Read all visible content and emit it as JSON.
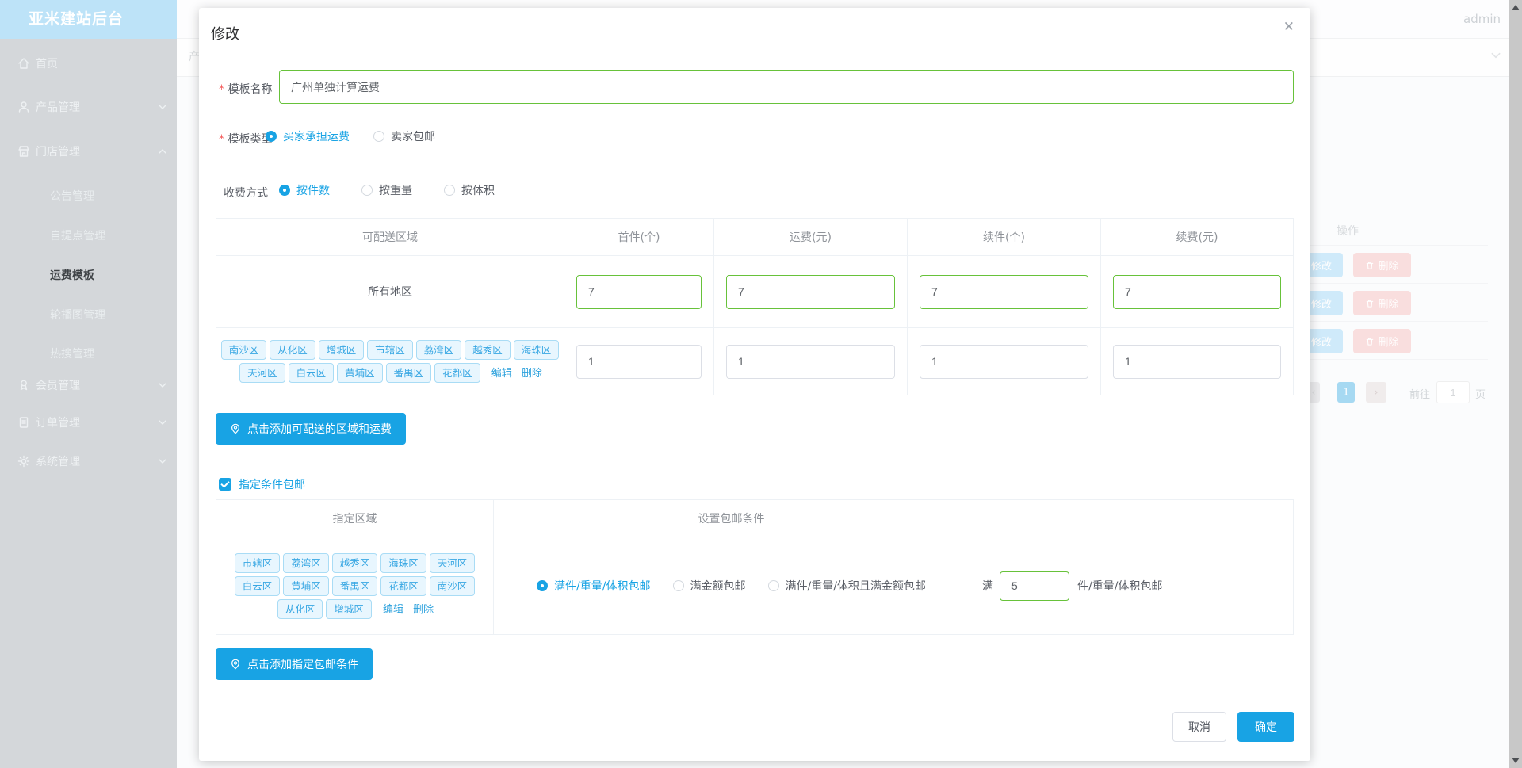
{
  "colors": {
    "primary": "#18a3e4",
    "success_green": "#67c23a",
    "tag_bg": "#e8f6fe",
    "tag_border": "#a9dcf5",
    "tag_text": "#38a7e3",
    "sidebar_header": "#bde3f8"
  },
  "sidebar": {
    "title": "亚米建站后台",
    "items": [
      {
        "label": "首页",
        "icon": "home-icon"
      },
      {
        "label": "产品管理",
        "icon": "user-icon",
        "chevron": "down"
      },
      {
        "label": "门店管理",
        "icon": "shop-icon",
        "chevron": "up",
        "children": [
          "公告管理",
          "自提点管理",
          "运费模板",
          "轮播图管理",
          "热搜管理"
        ],
        "active_child": "运费模板"
      },
      {
        "label": "会员管理",
        "icon": "member-icon",
        "chevron": "down"
      },
      {
        "label": "订单管理",
        "icon": "order-icon",
        "chevron": "down"
      },
      {
        "label": "系统管理",
        "icon": "gear-icon",
        "chevron": "down"
      }
    ]
  },
  "topbar": {
    "username": "admin",
    "tab_fragment": "产"
  },
  "background_table": {
    "action_header": "操作",
    "edit_label": "修改",
    "delete_label": "删除",
    "pagination": {
      "current_page": "1",
      "goto_label": "前往",
      "goto_value": "1",
      "page_unit": "页"
    }
  },
  "modal": {
    "title": "修改",
    "close": "✕",
    "template_name": {
      "label": "模板名称",
      "value": "广州单独计算运费"
    },
    "template_type": {
      "label": "模板类型",
      "options": [
        "买家承担运费",
        "卖家包邮"
      ],
      "selected": "买家承担运费"
    },
    "charge_method": {
      "label": "收费方式",
      "options": [
        "按件数",
        "按重量",
        "按体积"
      ],
      "selected": "按件数"
    },
    "shipping_table": {
      "headers": [
        "可配送区域",
        "首件(个)",
        "运费(元)",
        "续件(个)",
        "续费(元)"
      ],
      "row_all": {
        "region": "所有地区",
        "values": [
          "7",
          "7",
          "7",
          "7"
        ]
      },
      "row_custom": {
        "tags_line1": [
          "南沙区",
          "从化区",
          "增城区",
          "市辖区",
          "荔湾区",
          "越秀区",
          "海珠区"
        ],
        "tags_line2": [
          "天河区",
          "白云区",
          "黄埔区",
          "番禺区",
          "花都区"
        ],
        "edit": "编辑",
        "delete": "删除",
        "values": [
          "1",
          "1",
          "1",
          "1"
        ]
      }
    },
    "add_region_button": "点击添加可配送的区域和运费",
    "free_condition_checkbox": {
      "label": "指定条件包邮",
      "checked": true
    },
    "condition_table": {
      "headers": [
        "指定区域",
        "设置包邮条件",
        ""
      ],
      "tags_line1": [
        "市辖区",
        "荔湾区",
        "越秀区",
        "海珠区",
        "天河区"
      ],
      "tags_line2": [
        "白云区",
        "黄埔区",
        "番禺区",
        "花都区",
        "南沙区"
      ],
      "tags_line3": [
        "从化区",
        "增城区"
      ],
      "edit": "编辑",
      "delete": "删除",
      "options": [
        "满件/重量/体积包邮",
        "满金额包邮",
        "满件/重量/体积且满金额包邮"
      ],
      "selected": "满件/重量/体积包邮",
      "condition_prefix": "满",
      "condition_value": "5",
      "condition_suffix": "件/重量/体积包邮"
    },
    "add_condition_button": "点击添加指定包邮条件",
    "footer": {
      "cancel": "取消",
      "confirm": "确定"
    }
  }
}
